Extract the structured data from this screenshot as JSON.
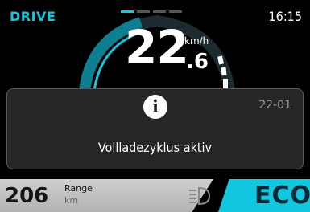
{
  "status": {
    "mode": "DRIVE",
    "time": "16:15"
  },
  "pagination": {
    "total": 4,
    "active": 0
  },
  "speed": {
    "integer": "22",
    "decimal": ".6",
    "unit": "km/h"
  },
  "popup": {
    "icon": "info-icon",
    "code": "22-01",
    "message": "Vollladezyklus aktiv"
  },
  "range": {
    "value": "206",
    "label": "Range",
    "unit": "km"
  },
  "light": {
    "icon": "headlight-icon"
  },
  "ride_mode": {
    "label": "ECO"
  },
  "colors": {
    "accent": "#12c7e0",
    "popup_bg": "#262626",
    "range_bg": "#c4c4c4"
  }
}
